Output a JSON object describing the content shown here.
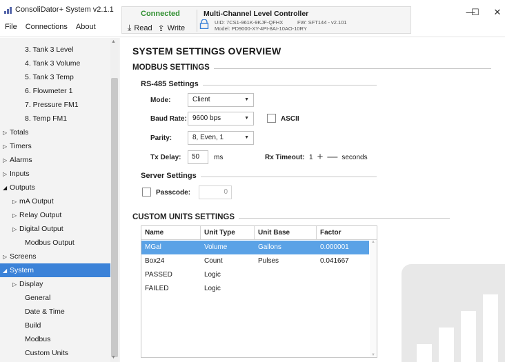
{
  "app": {
    "title": "ConsoliDator+ System v2.1.1",
    "menu": [
      "File",
      "Connections",
      "About"
    ]
  },
  "connection": {
    "status": "Connected",
    "read_label": "Read",
    "write_label": "Write",
    "device_title": "Multi-Channel Level Controller",
    "uid": "UID: 7CS1-961K-9KJF-QFHX",
    "model": "Model: PD9000-XY-4PI-8AI-10AO-10RY",
    "fw": "FW: SFT144 - v2.101",
    "status_color": "#2f8f2f"
  },
  "window_controls": {
    "minimize": "—",
    "maximize": "☐",
    "close": "✕"
  },
  "sidebar": {
    "items": [
      {
        "label": "3. Tank 3 Level",
        "tri": ""
      },
      {
        "label": "4. Tank 3 Volume",
        "tri": ""
      },
      {
        "label": "5. Tank 3 Temp",
        "tri": ""
      },
      {
        "label": "6. Flowmeter 1",
        "tri": ""
      },
      {
        "label": "7. Pressure FM1",
        "tri": ""
      },
      {
        "label": "8. Temp FM1",
        "tri": ""
      },
      {
        "label": "Totals",
        "tri": "▷"
      },
      {
        "label": "Timers",
        "tri": "▷"
      },
      {
        "label": "Alarms",
        "tri": "▷"
      },
      {
        "label": "Inputs",
        "tri": "▷"
      },
      {
        "label": "Outputs",
        "tri": "◢"
      },
      {
        "label": "mA Output",
        "tri": "▷"
      },
      {
        "label": "Relay Output",
        "tri": "▷"
      },
      {
        "label": "Digital Output",
        "tri": "▷"
      },
      {
        "label": "Modbus Output",
        "tri": ""
      },
      {
        "label": "Screens",
        "tri": "▷"
      },
      {
        "label": "System",
        "tri": "◢"
      },
      {
        "label": "Display",
        "tri": "▷"
      },
      {
        "label": "General",
        "tri": ""
      },
      {
        "label": "Date & Time",
        "tri": ""
      },
      {
        "label": "Build",
        "tri": ""
      },
      {
        "label": "Modbus",
        "tri": ""
      },
      {
        "label": "Custom Units",
        "tri": ""
      }
    ],
    "selected_color": "#3b82d8"
  },
  "main": {
    "title": "SYSTEM SETTINGS OVERVIEW",
    "modbus": {
      "section_title": "MODBUS SETTINGS",
      "rs485_title": "RS-485 Settings",
      "mode_label": "Mode:",
      "mode_value": "Client",
      "baud_label": "Baud Rate:",
      "baud_value": "9600 bps",
      "ascii_label": "ASCII",
      "parity_label": "Parity:",
      "parity_value": "8, Even, 1",
      "txdelay_label": "Tx Delay:",
      "txdelay_value": "50",
      "txdelay_unit": "ms",
      "rxtimeout_label": "Rx Timeout:",
      "rxtimeout_value": "1",
      "rxtimeout_unit": "seconds",
      "plus": "+",
      "minus": "—",
      "server_title": "Server Settings",
      "passcode_label": "Passcode:",
      "passcode_value": "0"
    },
    "custom_units": {
      "section_title": "CUSTOM UNITS SETTINGS",
      "headers": [
        "Name",
        "Unit Type",
        "Unit Base",
        "Factor"
      ],
      "rows": [
        [
          "MGal",
          "Volume",
          "Gallons",
          "0.000001"
        ],
        [
          "Box24",
          "Count",
          "Pulses",
          "0.041667"
        ],
        [
          "PASSED",
          "Logic",
          "",
          ""
        ],
        [
          "FAILED",
          "Logic",
          "",
          ""
        ]
      ],
      "selected_row_color": "#5aa2e6"
    }
  }
}
